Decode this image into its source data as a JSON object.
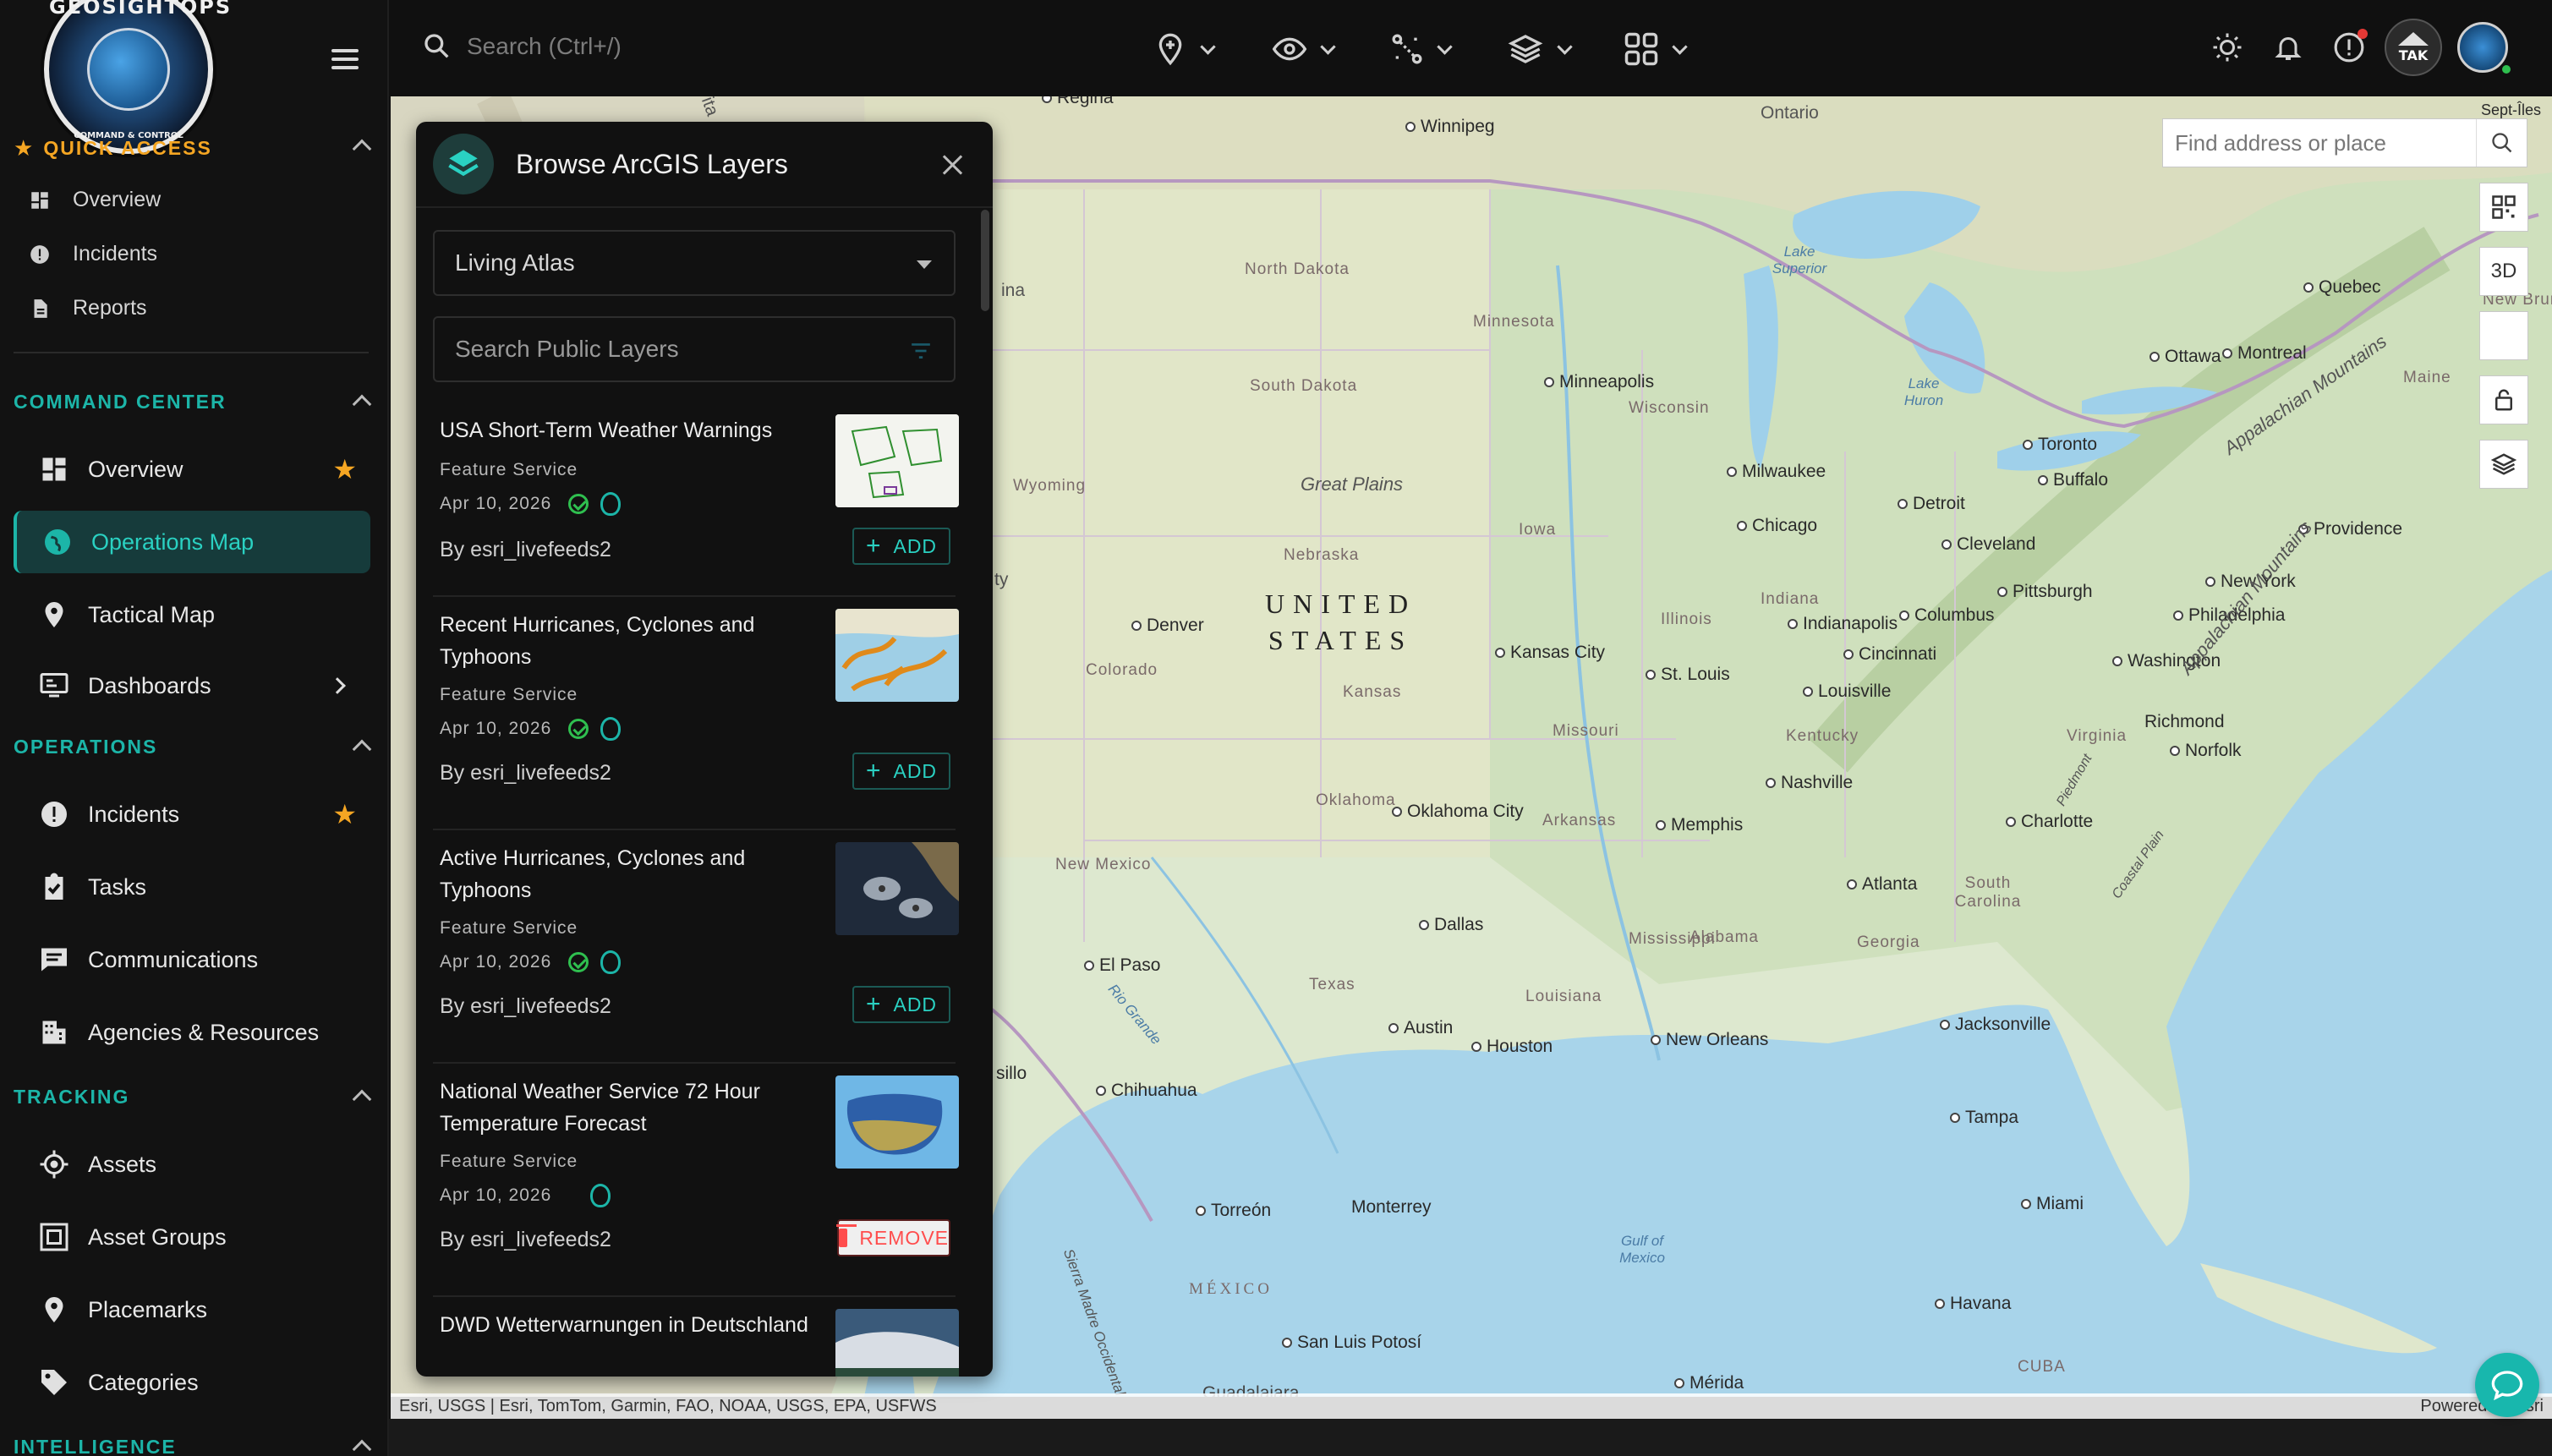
{
  "app": {
    "logo_text": "GEOSIGHTOPS",
    "logo_sub": "COMMAND & CONTROL"
  },
  "sidebar": {
    "quick_access": {
      "title": "QUICK ACCESS",
      "items": [
        {
          "label": "Overview"
        },
        {
          "label": "Incidents"
        },
        {
          "label": "Reports"
        }
      ]
    },
    "sections": [
      {
        "title": "COMMAND CENTER",
        "items": [
          {
            "label": "Overview",
            "starred": true
          },
          {
            "label": "Operations Map",
            "active": true
          },
          {
            "label": "Tactical Map"
          },
          {
            "label": "Dashboards",
            "has_submenu": true
          }
        ]
      },
      {
        "title": "OPERATIONS",
        "items": [
          {
            "label": "Incidents",
            "starred": true
          },
          {
            "label": "Tasks"
          },
          {
            "label": "Communications"
          },
          {
            "label": "Agencies & Resources"
          }
        ]
      },
      {
        "title": "TRACKING",
        "items": [
          {
            "label": "Assets"
          },
          {
            "label": "Asset Groups"
          },
          {
            "label": "Placemarks"
          },
          {
            "label": "Categories"
          }
        ]
      },
      {
        "title": "INTELLIGENCE",
        "items": []
      }
    ]
  },
  "topbar": {
    "search_placeholder": "Search (Ctrl+/)",
    "tools": [
      "add-marker-icon",
      "visibility-icon",
      "route-icon",
      "layers-icon",
      "apps-grid-icon"
    ],
    "right_icons": [
      "brightness-icon",
      "bell-icon",
      "alert-icon",
      "tak-avatar",
      "user-avatar"
    ],
    "tak_label": "TAK"
  },
  "panel": {
    "title": "Browse ArcGIS Layers",
    "source_select": "Living Atlas",
    "search_placeholder": "Search Public Layers",
    "layers": [
      {
        "title": "USA Short-Term Weather Warnings",
        "type": "Feature Service",
        "date": "Apr 10, 2026",
        "verified": true,
        "author": "By esri_livefeeds2",
        "action": "ADD"
      },
      {
        "title": "Recent Hurricanes, Cyclones and Typhoons",
        "type": "Feature Service",
        "date": "Apr 10, 2026",
        "verified": true,
        "author": "By esri_livefeeds2",
        "action": "ADD"
      },
      {
        "title": "Active Hurricanes, Cyclones and Typhoons",
        "type": "Feature Service",
        "date": "Apr 10, 2026",
        "verified": true,
        "author": "By esri_livefeeds2",
        "action": "ADD"
      },
      {
        "title": "National Weather Service 72 Hour Temperature Forecast",
        "type": "Feature Service",
        "date": "Apr 10, 2026",
        "verified": false,
        "author": "By esri_livefeeds2",
        "action": "REMOVE"
      },
      {
        "title": "DWD Wetterwarnungen in Deutschland",
        "type": "Feature Service",
        "date": "",
        "verified": true,
        "author": "",
        "action": ""
      }
    ]
  },
  "map": {
    "address_placeholder": "Find address or place",
    "button_3d": "3D",
    "attribution": "Esri, USGS | Esri, TomTom, Garmin, FAO, NOAA, USGS, EPA, USFWS",
    "powered_by": "Powered by Esri",
    "country_label_1": "UNITED",
    "country_label_2": "STATES",
    "labels": {
      "regina": "Regina",
      "winnipeg": "Winnipeg",
      "ontario": "Ontario",
      "septiles": "Sept-Îles",
      "quebec": "Quebec",
      "ottawa": "Ottawa",
      "montreal": "Montreal",
      "maine": "Maine",
      "newbrunswick": "New Bruns",
      "toronto": "Toronto",
      "buffalo": "Buffalo",
      "providence": "Providence",
      "newyork": "New York",
      "philadelphia": "Philadelphia",
      "washington": "Washington",
      "richmond": "Richmond",
      "norfolk": "Norfolk",
      "northdakota": "North Dakota",
      "southdakota": "South Dakota",
      "minnesota": "Minnesota",
      "minneapolis": "Minneapolis",
      "wisconsin": "Wisconsin",
      "milwaukee": "Milwaukee",
      "chicago": "Chicago",
      "detroit": "Detroit",
      "cleveland": "Cleveland",
      "pittsburgh": "Pittsburgh",
      "columbus": "Columbus",
      "indianapolis": "Indianapolis",
      "cincinnati": "Cincinnati",
      "louisville": "Louisville",
      "iowa": "Iowa",
      "illinois": "Illinois",
      "indiana": "Indiana",
      "nebraska": "Nebraska",
      "kansas": "Kansas",
      "kansascity": "Kansas City",
      "stlouis": "St. Louis",
      "missouri": "Missouri",
      "kentucky": "Kentucky",
      "nashville": "Nashville",
      "virginia": "Virginia",
      "charlotte": "Charlotte",
      "southcarolina": "South Carolina",
      "atlanta": "Atlanta",
      "georgia": "Georgia",
      "alabama": "Alabama",
      "mississippi": "Mississippi",
      "memphis": "Memphis",
      "arkansas": "Arkansas",
      "oklahoma": "Oklahoma",
      "oklahomacity": "Oklahoma City",
      "texas": "Texas",
      "dallas": "Dallas",
      "austin": "Austin",
      "houston": "Houston",
      "louisiana": "Louisiana",
      "neworleans": "New Orleans",
      "jacksonville": "Jacksonville",
      "tampa": "Tampa",
      "miami": "Miami",
      "havana": "Havana",
      "cuba": "CUBA",
      "merida": "Mérida",
      "denver": "Denver",
      "colorado": "Colorado",
      "wyoming": "Wyoming",
      "newmexico": "New Mexico",
      "elpaso": "El Paso",
      "chihuahua": "Chihuahua",
      "torreon": "Torreón",
      "monterrey": "Monterrey",
      "mexico": "MÉXICO",
      "sanluispotosi": "San Luis Potosí",
      "guadalajara": "Guadalajara",
      "greatplains": "Great Plains",
      "lakesuperior": "Lake Superior",
      "lakehuron": "Lake Huron",
      "gulfofmexico": "Gulf of Mexico",
      "appalachian": "Appalachian Mountains",
      "riogrande": "Rio Grande",
      "sierra": "Sierra Madre Occidental",
      "piedmont": "Piedmont",
      "coastalplain": "Coastal Plain",
      "ina": "ina",
      "ty": "ty",
      "sillo": "sillo",
      "ita": "ita"
    }
  },
  "colors": {
    "accent": "#1cb5a8",
    "star": "#f5a623",
    "remove": "#ff4d4d",
    "sidebar_bg": "#121212"
  }
}
